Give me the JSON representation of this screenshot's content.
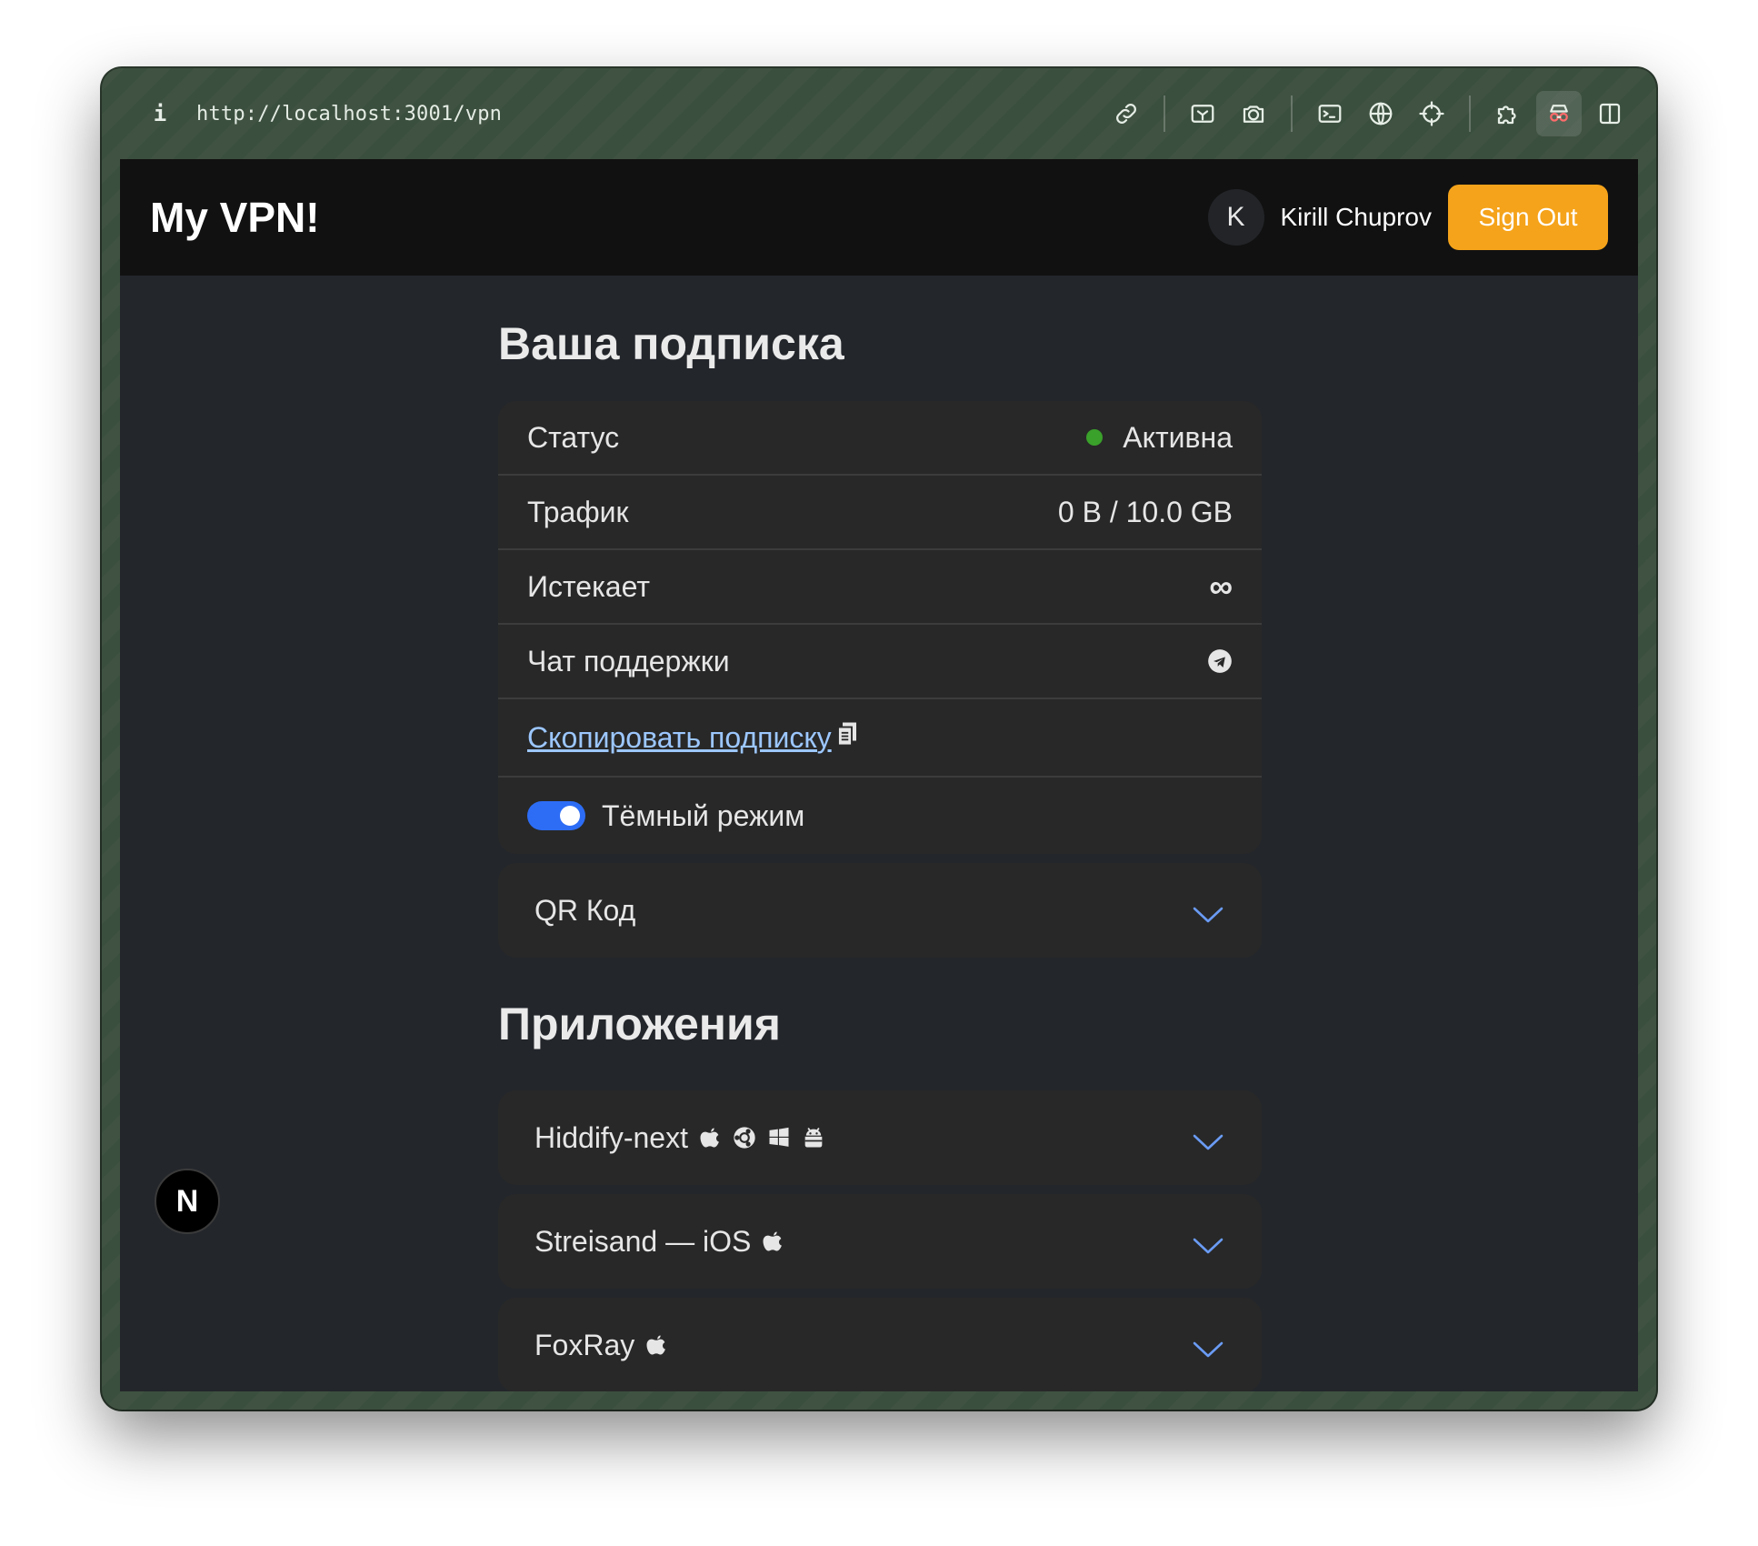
{
  "browser": {
    "info_label": "i",
    "url": "http://localhost:3001/vpn",
    "toolbar_icons": [
      "link-icon",
      "image-edit-icon",
      "camera-icon",
      "terminal-icon",
      "globe-icon",
      "crosshair-icon",
      "puzzle-icon",
      "spy-icon",
      "split-view-icon"
    ]
  },
  "header": {
    "brand": "My VPN!",
    "avatar_initial": "K",
    "username": "Kirill Chuprov",
    "signout_label": "Sign Out"
  },
  "subscription": {
    "title": "Ваша подписка",
    "rows": [
      {
        "label": "Статус",
        "value": "Активна",
        "status_color": "#3aa12a"
      },
      {
        "label": "Трафик",
        "value": "0 B / 10.0 GB"
      },
      {
        "label": "Истекает",
        "value": "∞"
      },
      {
        "label": "Чат поддержки",
        "value_icon": "telegram-icon"
      }
    ],
    "copy_label": "Скопировать подписку",
    "dark_mode_label": "Тёмный режим",
    "dark_mode_on": true
  },
  "qr": {
    "label": "QR Код"
  },
  "apps": {
    "title": "Приложения",
    "items": [
      {
        "name": "Hiddify-next",
        "platforms": [
          "apple-icon",
          "ubuntu-icon",
          "windows-icon",
          "android-icon"
        ]
      },
      {
        "name": "Streisand — iOS",
        "platforms": [
          "apple-icon"
        ]
      },
      {
        "name": "FoxRay",
        "platforms": [
          "apple-icon"
        ]
      }
    ]
  },
  "next_badge": "N",
  "colors": {
    "accent": "#f5a31a",
    "toggle": "#2d6df6",
    "chevron": "#6a9bf4",
    "link": "#9cc7ff",
    "status": "#3aa12a"
  }
}
